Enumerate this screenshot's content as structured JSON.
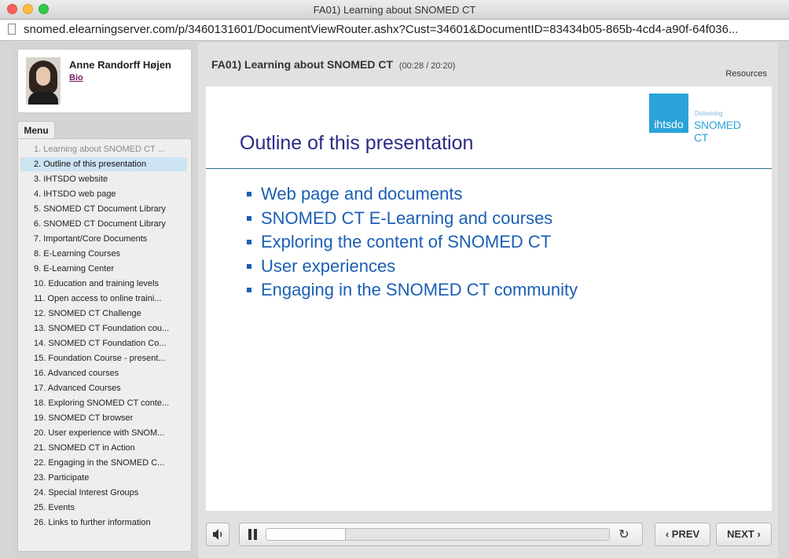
{
  "window": {
    "title": "FA01) Learning about SNOMED CT",
    "url": "snomed.elearningserver.com/p/3460131601/DocumentViewRouter.ashx?Cust=34601&DocumentID=83434b05-865b-4cd4-a90f-64f036..."
  },
  "presenter": {
    "name": "Anne Randorff Højen",
    "bio_label": "Bio"
  },
  "menu": {
    "tab_label": "Menu",
    "items": [
      {
        "label": "1. Learning about SNOMED CT ...",
        "state": "visited"
      },
      {
        "label": "2. Outline of this presentation",
        "state": "active"
      },
      {
        "label": "3. IHTSDO website",
        "state": "normal"
      },
      {
        "label": "4. IHTSDO web page",
        "state": "normal"
      },
      {
        "label": "5. SNOMED CT Document Library",
        "state": "normal"
      },
      {
        "label": "6. SNOMED CT Document Library",
        "state": "normal"
      },
      {
        "label": "7. Important/Core Documents",
        "state": "normal"
      },
      {
        "label": "8.  E-Learning Courses",
        "state": "normal"
      },
      {
        "label": "9. E-Learning Center",
        "state": "normal"
      },
      {
        "label": "10. Education and training levels",
        "state": "normal"
      },
      {
        "label": "11. Open access to online traini...",
        "state": "normal"
      },
      {
        "label": "12. SNOMED CT Challenge",
        "state": "normal"
      },
      {
        "label": "13. SNOMED CT Foundation cou...",
        "state": "normal"
      },
      {
        "label": "14. SNOMED CT Foundation Co...",
        "state": "normal"
      },
      {
        "label": "15. Foundation Course - present...",
        "state": "normal"
      },
      {
        "label": "16. Advanced courses",
        "state": "normal"
      },
      {
        "label": "17. Advanced Courses",
        "state": "normal"
      },
      {
        "label": "18. Exploring SNOMED CT conte...",
        "state": "normal"
      },
      {
        "label": "19. SNOMED CT browser",
        "state": "normal"
      },
      {
        "label": "20. User experience with SNOM...",
        "state": "normal"
      },
      {
        "label": "21. SNOMED CT in Action",
        "state": "normal"
      },
      {
        "label": "22. Engaging in the SNOMED C...",
        "state": "normal"
      },
      {
        "label": "23. Participate",
        "state": "normal"
      },
      {
        "label": "24. Special Interest Groups",
        "state": "normal"
      },
      {
        "label": "25. Events",
        "state": "normal"
      },
      {
        "label": "26. Links to further information",
        "state": "normal"
      }
    ]
  },
  "header": {
    "title": "FA01) Learning about SNOMED CT",
    "time": "(00:28 / 20:20)",
    "resources_label": "Resources"
  },
  "slide": {
    "logo_left": "ihtsdo",
    "logo_small": "Delivering",
    "logo_right": "SNOMED CT",
    "heading": "Outline of this presentation",
    "bullets": [
      "Web page and documents",
      "SNOMED CT E-Learning and courses",
      "Exploring the content of SNOMED CT",
      "User experiences",
      "Engaging in the SNOMED CT community"
    ]
  },
  "controls": {
    "progress": 0.23,
    "prev_label": "PREV",
    "next_label": "NEXT",
    "prev_icon": "chevron-left-icon",
    "next_icon": "chevron-right-icon",
    "volume_icon": "speaker-icon",
    "pause_icon": "pause-icon",
    "replay_icon": "replay-icon"
  },
  "colors": {
    "active_item_bg": "#cde4f3",
    "slide_heading": "#2a2b87",
    "bullet_text": "#1a5fb4",
    "logo_blue": "#2ba3d9",
    "bio_link": "#7b1c62"
  }
}
